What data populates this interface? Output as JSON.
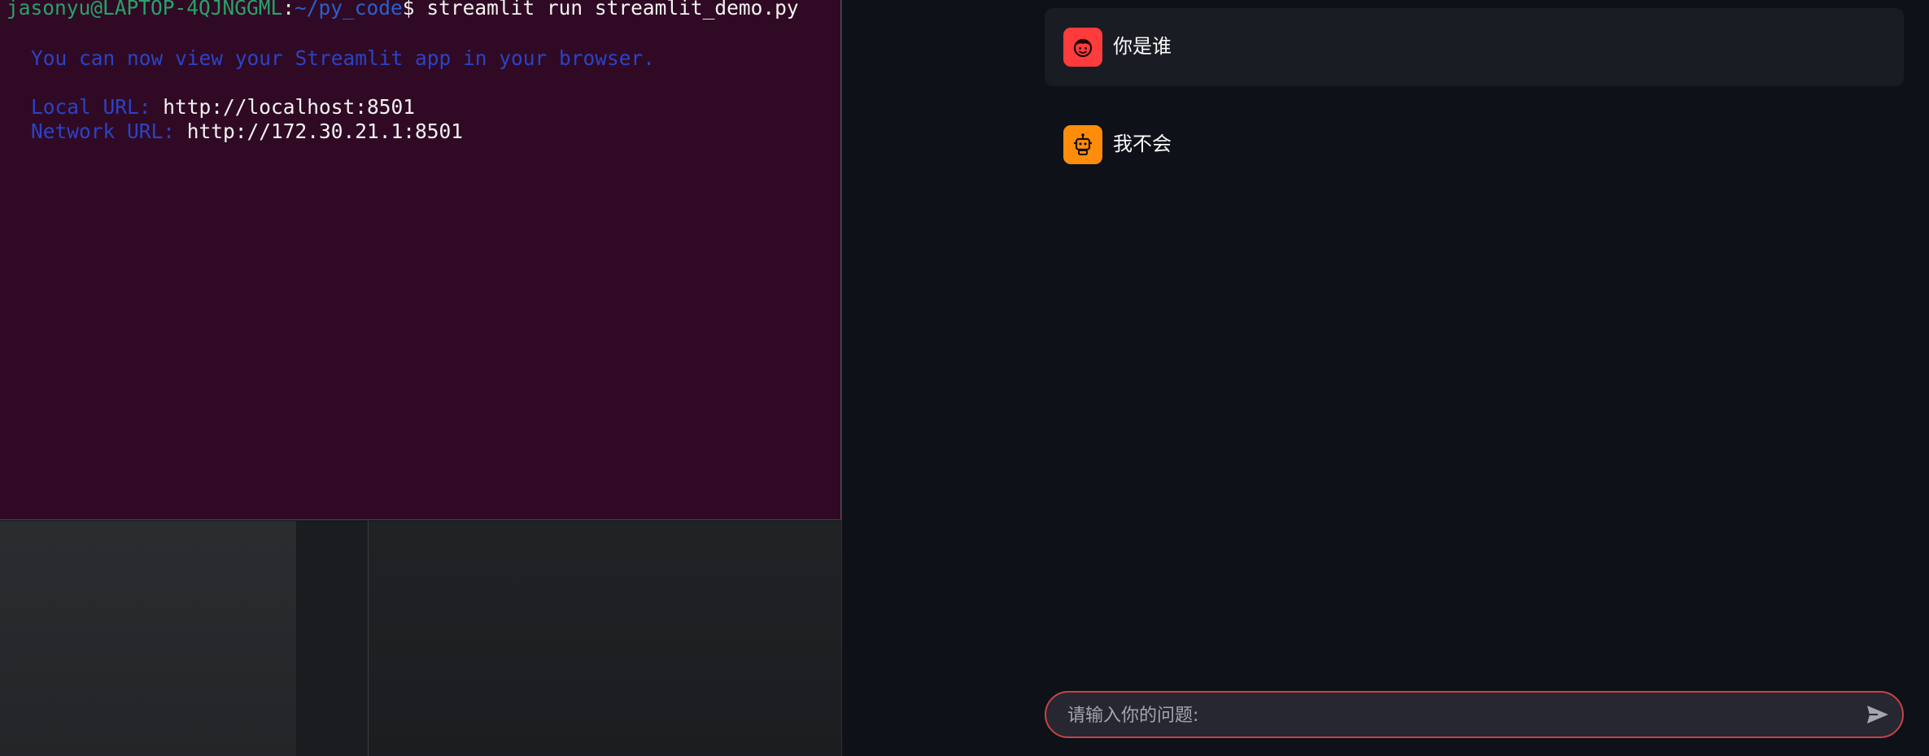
{
  "terminal": {
    "prompt_user": "jasonyu@LAPTOP-4QJNGGML",
    "prompt_colon": ":",
    "prompt_path": "~/py_code",
    "prompt_dollar": "$ ",
    "command": "streamlit run streamlit_demo.py",
    "info_line": "You can now view your Streamlit app in your browser.",
    "local_label": "Local URL: ",
    "local_url": "http://localhost:8501",
    "network_label": "Network URL: ",
    "network_url": "http://172.30.21.1:8501"
  },
  "chat": {
    "messages": [
      {
        "role": "user",
        "avatar_icon": "user-face-icon",
        "text": "你是谁"
      },
      {
        "role": "assistant",
        "avatar_icon": "robot-icon",
        "text": "我不会"
      }
    ],
    "input": {
      "placeholder": "请输入你的问题:",
      "value": "",
      "send_icon": "send-icon"
    }
  },
  "colors": {
    "terminal_bg": "#300a24",
    "chat_bg": "#0e1117",
    "user_avatar": "#ff3b3b",
    "bot_avatar": "#ff8c0a",
    "input_border": "#c7424a"
  }
}
